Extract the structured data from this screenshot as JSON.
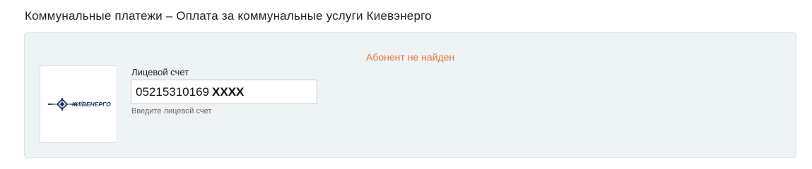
{
  "header": {
    "title": "Коммунальные платежи – Оплата за коммунальные услуги Киевэнерго"
  },
  "form": {
    "error_message": "Абонент не найден",
    "provider_logo": {
      "icon": "kyivenergo-logo-icon",
      "text": "КИЇВЕНЕРГО"
    },
    "account_field": {
      "label": "Лицевой счет",
      "value_digits": "05215310169",
      "value_masked": "XXXX",
      "hint": "Введите лицевой счет"
    }
  },
  "colors": {
    "panel_background": "#eef3f5",
    "error_text": "#e8743b",
    "logo_blue": "#1f2f5a"
  }
}
